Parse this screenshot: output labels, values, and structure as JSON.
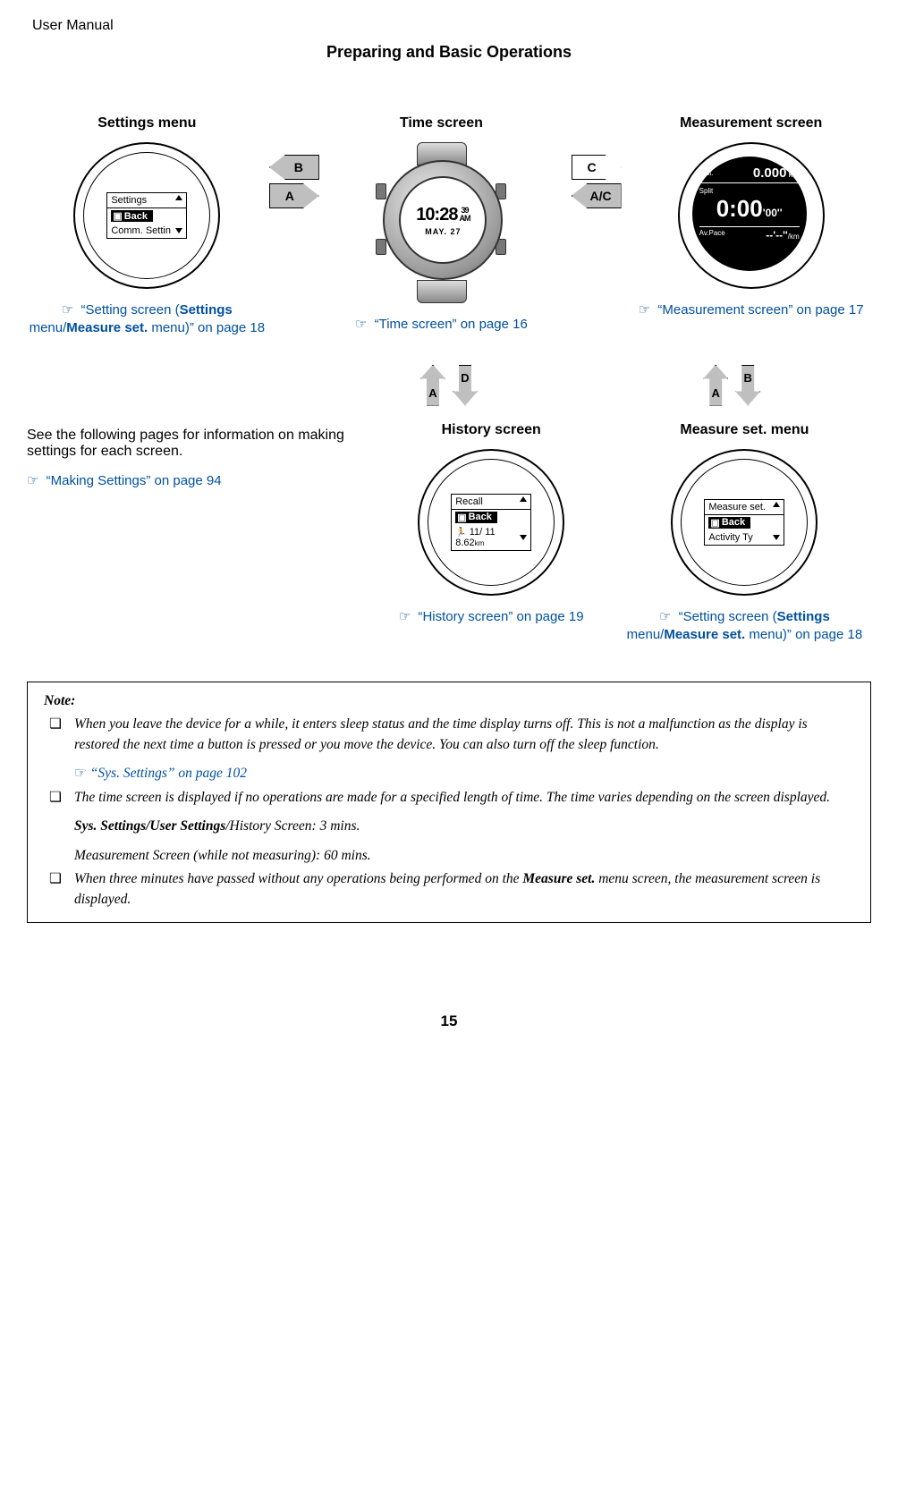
{
  "header": {
    "doc_title": "User Manual",
    "section_title": "Preparing and Basic Operations"
  },
  "labels": {
    "settings_menu": "Settings menu",
    "time_screen": "Time screen",
    "measurement_screen": "Measurement screen",
    "history_screen": "History screen",
    "measure_set_menu": "Measure set. menu"
  },
  "nav_buttons": {
    "A": "A",
    "B": "B",
    "C": "C",
    "D": "D",
    "AC": "A/C"
  },
  "lcd": {
    "settings": {
      "title": "Settings",
      "back": "Back",
      "row2": "Comm. Settin"
    },
    "recall": {
      "title": "Recall",
      "back": "Back",
      "row2": "11/ 11  8.62",
      "unit": "km"
    },
    "measure": {
      "title": "Measure set.",
      "back": "Back",
      "row2": "Activity Ty"
    }
  },
  "measurement_display": {
    "dist_label": "Dist.",
    "dist_value": "0.000",
    "dist_unit": "km",
    "split_label": "Split",
    "time_value": "0:00",
    "time_secs": "'00''",
    "avpace_label": "Av.Pace",
    "pace_value": "--'--''",
    "pace_unit": "/km"
  },
  "watch_display": {
    "time_main": "10:28",
    "secs": "39",
    "ampm": "AM",
    "date": "MAY. 27"
  },
  "refs": {
    "setting_1a": "“Setting screen (",
    "setting_1b": "Settings",
    "setting_1c": " menu/",
    "setting_1d": "Measure set.",
    "setting_1e": " menu)” on page 18",
    "time_screen": "“Time screen” on page 16",
    "measurement": "“Measurement screen” on page 17",
    "history": "“History screen” on page 19",
    "making_settings": "“Making Settings” on page 94",
    "sys_settings": "“Sys. Settings” on page 102"
  },
  "body_text": {
    "see_following": "See the following pages for information on making settings for each screen."
  },
  "note": {
    "title": "Note:",
    "p1": "When you leave the device for a while, it enters sleep status and the time display turns off. This is not a malfunction as the display is restored the next time a button is pressed or you move the device. You can also turn off the sleep function.",
    "p2": "The time screen is displayed if no operations are made for a specified length of time. The time varies depending on the screen displayed.",
    "p2a_bold": "Sys. Settings/User Settings",
    "p2a_rest": "/History Screen: 3 mins.",
    "p2b": "Measurement Screen (while not measuring): 60 mins.",
    "p3a": "When three minutes have passed without any operations being performed on the ",
    "p3b": "Measure set.",
    "p3c": " menu screen, the measurement screen is displayed."
  },
  "page_number": "15",
  "hand_icon": "☞"
}
